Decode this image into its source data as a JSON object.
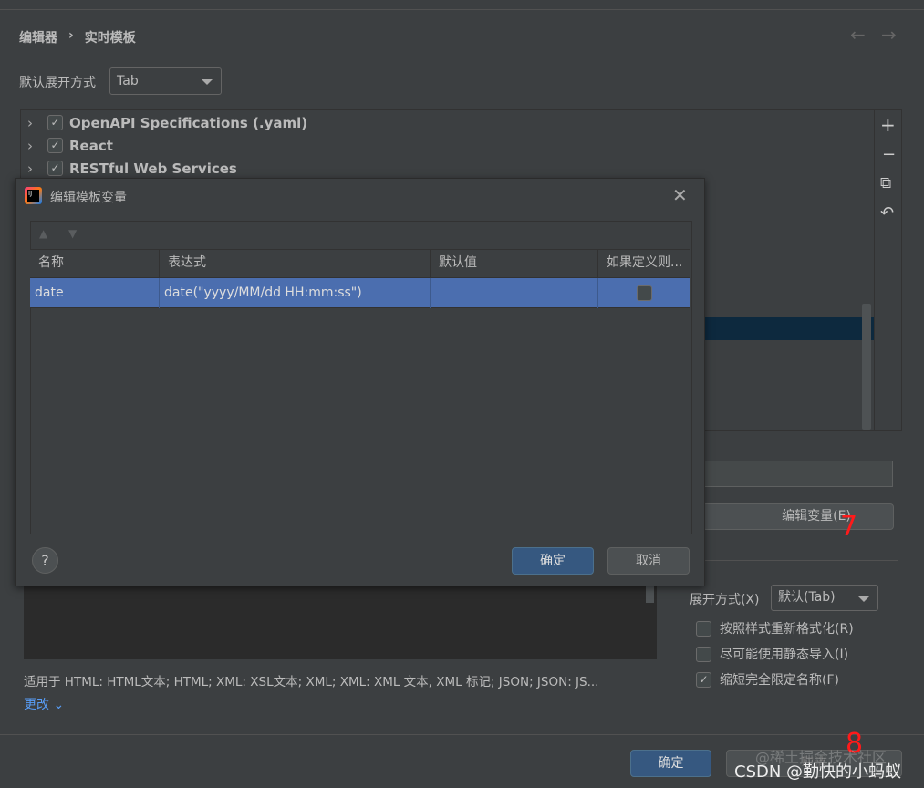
{
  "breadcrumb": {
    "parent": "编辑器",
    "separator": "›",
    "current": "实时模板"
  },
  "expand_default": {
    "label": "默认展开方式",
    "value": "Tab"
  },
  "tree": [
    {
      "label": "OpenAPI Specifications (.yaml)",
      "checked": true
    },
    {
      "label": "React",
      "checked": true
    },
    {
      "label": "RESTful Web Services",
      "checked": true
    }
  ],
  "toolbar": {
    "add": "+",
    "remove": "−",
    "copy": "⧉",
    "undo": "↶"
  },
  "edit_variables_button": "编辑变量(E)",
  "options": {
    "expand_label": "展开方式(X)",
    "expand_value": "默认(Tab)",
    "checks": [
      {
        "label": "按照样式重新格式化(R)",
        "checked": false
      },
      {
        "label": "尽可能使用静态导入(I)",
        "checked": false
      },
      {
        "label": "缩短完全限定名称(F)",
        "checked": true
      }
    ]
  },
  "applicable": "适用于 HTML: HTML文本; HTML; XML: XSL文本; XML; XML: XML 文本, XML 标记; JSON; JSON: JS...",
  "change_link": "更改",
  "footer": {
    "ok": "确定",
    "cancel": "取消"
  },
  "dialog": {
    "title": "编辑模板变量",
    "columns": [
      "名称",
      "表达式",
      "默认值",
      "如果定义则..."
    ],
    "rows": [
      {
        "name": "date",
        "expression": "date(\"yyyy/MM/dd HH:mm:ss\")",
        "default": "",
        "skip": false
      }
    ],
    "help": "?",
    "ok": "确定",
    "cancel": "取消"
  },
  "annotations": {
    "step7": "7",
    "step8": "8",
    "watermark1": "@稀土掘金技术社区",
    "watermark2": "CSDN @勤快的小蚂蚁"
  }
}
